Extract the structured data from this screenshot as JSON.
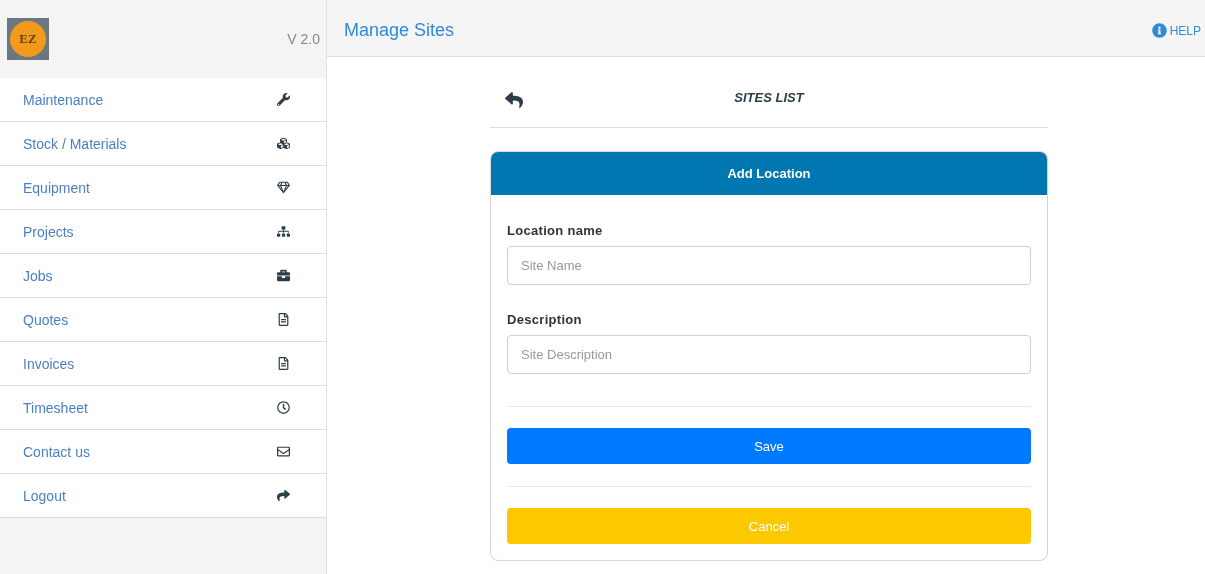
{
  "sidebar": {
    "logo_text": "EZ",
    "version": "V 2.0",
    "items": [
      {
        "label": "Maintenance"
      },
      {
        "label": "Stock / Materials"
      },
      {
        "label": "Equipment"
      },
      {
        "label": "Projects"
      },
      {
        "label": "Jobs"
      },
      {
        "label": "Quotes"
      },
      {
        "label": "Invoices"
      },
      {
        "label": "Timesheet"
      },
      {
        "label": "Contact us"
      },
      {
        "label": "Logout"
      }
    ]
  },
  "header": {
    "title": "Manage Sites",
    "help": "HELP"
  },
  "list_header": {
    "title": "SITES LIST"
  },
  "form": {
    "title": "Add Location",
    "fields": [
      {
        "label": "Location name",
        "placeholder": "Site Name"
      },
      {
        "label": "Description",
        "placeholder": "Site Description"
      }
    ],
    "buttons": [
      {
        "label": "Save",
        "kind": "primary"
      },
      {
        "label": "Cancel",
        "kind": "warning"
      }
    ]
  }
}
